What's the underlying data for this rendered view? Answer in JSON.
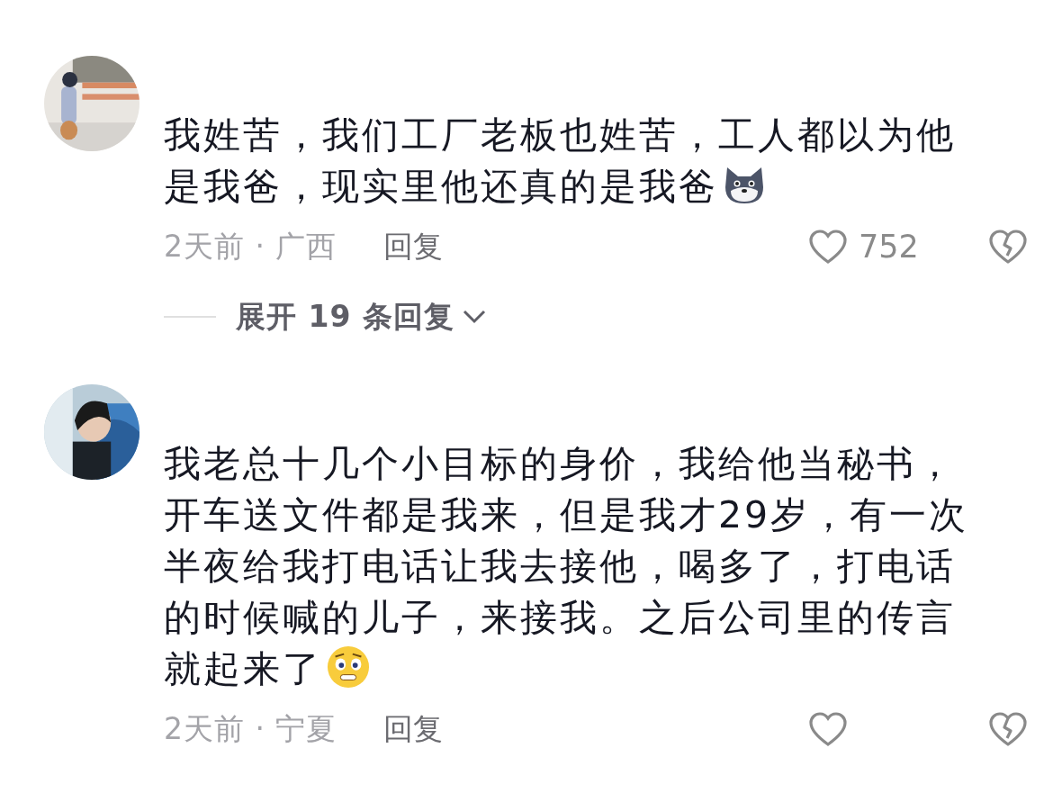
{
  "comments": [
    {
      "lines": [
        "我姓苦，我们工厂老板也姓苦，工人都以为他",
        "是我爸，现实里他还真的是我爸"
      ],
      "emoji": {
        "kind": "dog"
      },
      "meta": "2天前 · 广西",
      "reply": "回复",
      "likes": "752",
      "expand": "展开 19 条回复"
    },
    {
      "lines": [
        "我老总十几个小目标的身价，我给他当秘书，",
        "开车送文件都是我来，但是我才29岁，有一次",
        "半夜给我打电话让我去接他，喝多了，打电话",
        "的时候喊的儿子，来接我。之后公司里的传言",
        "就起来了"
      ],
      "emoji": {
        "kind": "worried"
      },
      "meta": "2天前 · 宁夏",
      "reply": "回复"
    }
  ]
}
